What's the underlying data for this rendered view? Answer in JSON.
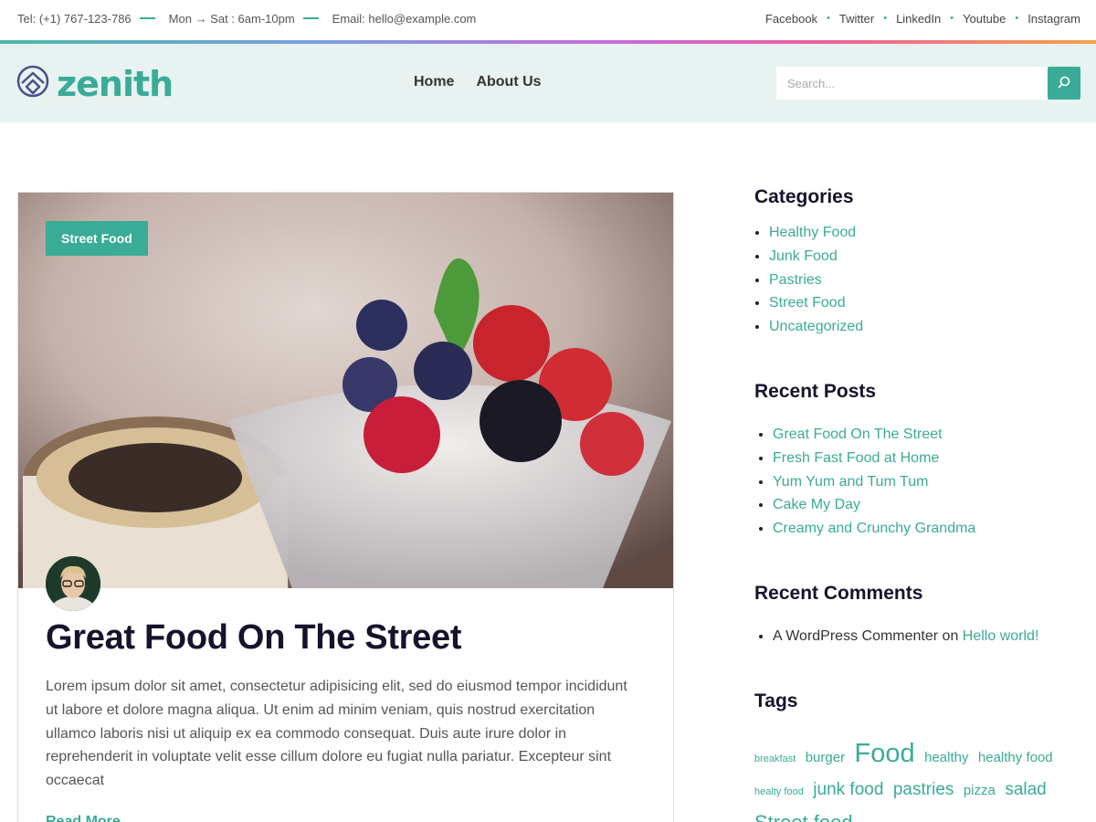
{
  "topbar": {
    "phone": "Tel: (+1) 767-123-786",
    "hours": "Mon → Sat : 6am-10pm",
    "email": "Email: hello@example.com",
    "social": [
      "Facebook",
      "Twitter",
      "LinkedIn",
      "Youtube",
      "Instagram"
    ]
  },
  "header": {
    "logo_text": "zenith",
    "nav": [
      "Home",
      "About Us"
    ],
    "search_placeholder": "Search..."
  },
  "post": {
    "category": "Street Food",
    "title": "Great Food On The Street",
    "excerpt": "Lorem ipsum dolor sit amet, consectetur adipisicing elit, sed do eiusmod tempor incididunt ut labore et dolore magna aliqua. Ut enim ad minim veniam, quis nostrud exercitation ullamco laboris nisi ut aliquip ex ea commodo consequat. Duis aute irure dolor in reprehenderit in voluptate velit esse cillum dolore eu fugiat nulla pariatur. Excepteur sint occaecat",
    "read_more": "Read More"
  },
  "sidebar": {
    "categories_title": "Categories",
    "categories": [
      "Healthy Food",
      "Junk Food",
      "Pastries",
      "Street Food",
      "Uncategorized"
    ],
    "recent_posts_title": "Recent Posts",
    "recent_posts": [
      "Great Food On The Street",
      "Fresh Fast Food at Home",
      "Yum Yum and Tum Tum",
      "Cake My Day",
      "Creamy and Crunchy Grandma"
    ],
    "recent_comments_title": "Recent Comments",
    "recent_comment": {
      "author": "A WordPress Commenter",
      "on": "on",
      "post": "Hello world!"
    },
    "tags_title": "Tags",
    "tags": [
      {
        "label": "breakfast",
        "size": 11
      },
      {
        "label": "burger",
        "size": 15
      },
      {
        "label": "Food",
        "size": 29
      },
      {
        "label": "healthy",
        "size": 15
      },
      {
        "label": "healthy food",
        "size": 15
      },
      {
        "label": "healty food",
        "size": 11
      },
      {
        "label": "junk food",
        "size": 19
      },
      {
        "label": "pastries",
        "size": 19
      },
      {
        "label": "pizza",
        "size": 15
      },
      {
        "label": "salad",
        "size": 19
      },
      {
        "label": "Street food",
        "size": 22
      }
    ]
  },
  "colors": {
    "accent": "#3aab97",
    "heading": "#17132b",
    "header_bg": "#e8f2f0"
  }
}
